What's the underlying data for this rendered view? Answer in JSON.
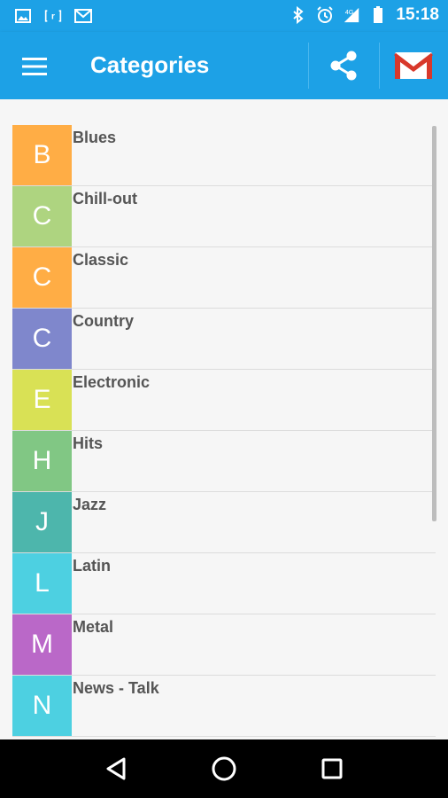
{
  "status_bar": {
    "time": "15:18",
    "left_icons": [
      "image-icon",
      "r-icon",
      "gmail-small-icon"
    ],
    "right_icons": [
      "bluetooth-icon",
      "alarm-icon",
      "signal-4g-icon",
      "battery-icon"
    ]
  },
  "app_bar": {
    "title": "Categories",
    "menu_icon": "hamburger-menu-icon",
    "actions": [
      "share-icon",
      "gmail-icon"
    ],
    "color": "#1da1e6"
  },
  "categories": [
    {
      "letter": "B",
      "label": "Blues",
      "color": "#ffad45"
    },
    {
      "letter": "C",
      "label": "Chill-out",
      "color": "#aed480"
    },
    {
      "letter": "C",
      "label": "Classic",
      "color": "#ffad45"
    },
    {
      "letter": "C",
      "label": "Country",
      "color": "#7f87cc"
    },
    {
      "letter": "E",
      "label": "Electronic",
      "color": "#d9e155"
    },
    {
      "letter": "H",
      "label": "Hits",
      "color": "#81c784"
    },
    {
      "letter": "J",
      "label": "Jazz",
      "color": "#4db6ac"
    },
    {
      "letter": "L",
      "label": "Latin",
      "color": "#4dd0e1"
    },
    {
      "letter": "M",
      "label": "Metal",
      "color": "#ba68c8"
    },
    {
      "letter": "N",
      "label": "News - Talk",
      "color": "#4dd0e1"
    }
  ],
  "nav_bar": [
    "back-icon",
    "home-icon",
    "recents-icon"
  ]
}
